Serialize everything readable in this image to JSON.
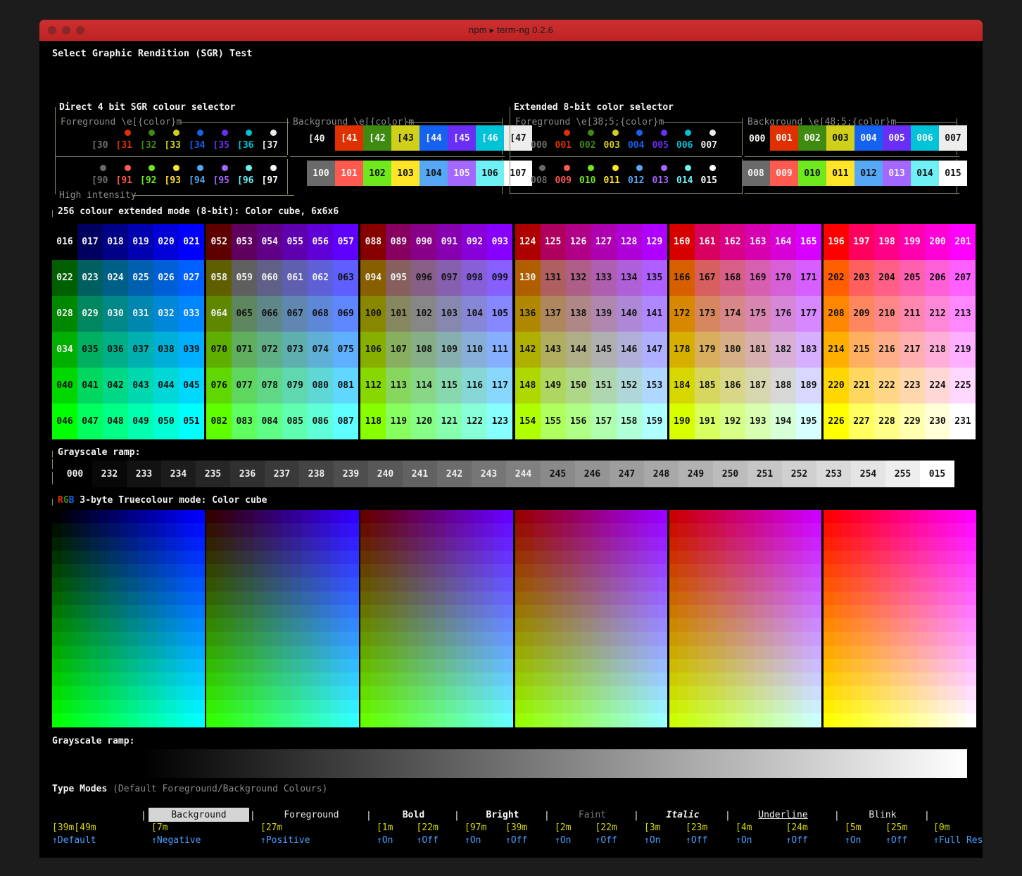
{
  "window": {
    "title": "npm ▸ term-ng 0.2.6",
    "traffic_lights": [
      "close",
      "minimize",
      "maximize"
    ]
  },
  "heading": "Select Graphic Rendition (SGR) Test",
  "four_bit": {
    "legend": "Direct 4 bit SGR colour selector",
    "footer_legend": "High intensity",
    "fg_legend": "Foreground \\e[{color}m",
    "bg_legend": "Background \\e[{color}m",
    "fg_normal_labels": [
      "[30",
      "[31",
      "[32",
      "[33",
      "[34",
      "[35",
      "[36",
      "[37"
    ],
    "fg_bright_labels": [
      "[90",
      "[91",
      "[92",
      "[93",
      "[94",
      "[95",
      "[96",
      "[97"
    ],
    "bg_normal_labels": [
      "[40",
      "[41",
      "[42",
      "[43",
      "[44",
      "[45",
      "[46",
      "[47"
    ],
    "bg_bright_labels": [
      "100",
      "101",
      "102",
      "103",
      "104",
      "105",
      "106",
      "107"
    ],
    "normal_colors": [
      "#555555",
      "#e03000",
      "#3f8a10",
      "#d0cf1a",
      "#1562f0",
      "#6a2ff5",
      "#00c3d8",
      "#ededed"
    ],
    "bright_colors": [
      "#6a6a6a",
      "#ff5a50",
      "#6fe81d",
      "#ffe528",
      "#56a8f5",
      "#a368ff",
      "#6ff0f5",
      "#ffffff"
    ]
  },
  "eight_bit": {
    "legend": "Extended 8-bit color selector",
    "fg_legend": "Foreground \\e[38;5;{color}m",
    "bg_legend": "Background \\e[48;5;{color}m",
    "fg_normal_labels": [
      "000",
      "001",
      "002",
      "003",
      "004",
      "005",
      "006",
      "007"
    ],
    "fg_bright_labels": [
      "008",
      "009",
      "010",
      "011",
      "012",
      "013",
      "014",
      "015"
    ],
    "bg_normal_labels": [
      "000",
      "001",
      "002",
      "003",
      "004",
      "005",
      "006",
      "007"
    ],
    "bg_bright_labels": [
      "008",
      "009",
      "010",
      "011",
      "012",
      "013",
      "014",
      "015"
    ]
  },
  "cube": {
    "legend": "256 colour extended mode (8-bit): Color cube, 6x6x6",
    "levels": [
      0,
      95,
      135,
      175,
      215,
      255
    ],
    "start_index": 16,
    "panels": 6,
    "rows": 6,
    "cols": 6
  },
  "gray_ramp_8bit": {
    "legend": "Grayscale ramp:",
    "labels": [
      "000",
      "232",
      "233",
      "234",
      "235",
      "236",
      "237",
      "238",
      "239",
      "240",
      "241",
      "242",
      "243",
      "244",
      "245",
      "246",
      "247",
      "248",
      "249",
      "250",
      "251",
      "252",
      "253",
      "254",
      "255",
      "015"
    ],
    "values": [
      0,
      8,
      18,
      28,
      38,
      48,
      58,
      68,
      78,
      88,
      98,
      108,
      118,
      128,
      138,
      148,
      158,
      168,
      178,
      188,
      198,
      208,
      218,
      228,
      238,
      255
    ]
  },
  "truecolour": {
    "legend_rgb": "RGB",
    "legend": " 3-byte Truecolour mode: Color cube",
    "red_levels": [
      0,
      51,
      102,
      153,
      204,
      255
    ],
    "steps": 16
  },
  "gray_ramp_true": {
    "legend": "Grayscale ramp:",
    "from": "#000000",
    "to": "#ffffff"
  },
  "type_modes": {
    "title": "Type Modes",
    "subtitle": "(Default Foreground/Background Colours)",
    "reset_codes": "[39m[49m",
    "reset_label": "↑Default",
    "groups": [
      {
        "name": "Background",
        "style": "negative",
        "codes": [
          "[7m"
        ],
        "labels": [
          "↑Negative"
        ]
      },
      {
        "name": "Foreground",
        "style": "normal",
        "codes": [
          "[27m"
        ],
        "labels": [
          "↑Positive"
        ]
      },
      {
        "name": "Bold",
        "style": "bold",
        "codes": [
          "[1m",
          "[22m"
        ],
        "labels": [
          "↑On",
          "↑Off"
        ]
      },
      {
        "name": "Bright",
        "style": "bright",
        "codes": [
          "[97m",
          "[39m"
        ],
        "labels": [
          "↑On",
          "↑Off"
        ]
      },
      {
        "name": "Faint",
        "style": "faint",
        "codes": [
          "[2m",
          "[22m"
        ],
        "labels": [
          "↑On",
          "↑Off"
        ]
      },
      {
        "name": "Italic",
        "style": "italic",
        "codes": [
          "[3m",
          "[23m"
        ],
        "labels": [
          "↑On",
          "↑Off"
        ]
      },
      {
        "name": "Underline",
        "style": "underline",
        "codes": [
          "[4m",
          "[24m"
        ],
        "labels": [
          "↑On",
          "↑Off"
        ]
      },
      {
        "name": "Blink",
        "style": "blink",
        "codes": [
          "[5m",
          "[25m"
        ],
        "labels": [
          "↑On",
          "↑Off"
        ]
      }
    ],
    "full_reset_code": "[0m",
    "full_reset_label": "↑Full Reset",
    "separator": "|"
  },
  "colors": {
    "accent": "#c62828",
    "frame": "#8a8a6a",
    "yellow": "#d7d700",
    "blue": "#4a9eff",
    "dim": "#8a8a8a"
  }
}
